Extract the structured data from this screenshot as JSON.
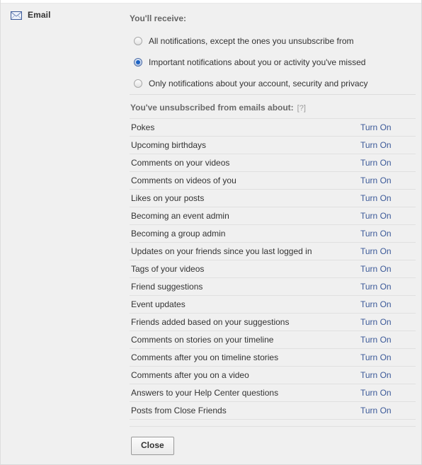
{
  "section": {
    "icon": "envelope-icon",
    "title": "Email"
  },
  "receive": {
    "heading": "You'll receive:",
    "options": [
      {
        "label": "All notifications, except the ones you unsubscribe from",
        "selected": false
      },
      {
        "label": "Important notifications about you or activity you've missed",
        "selected": true
      },
      {
        "label": "Only notifications about your account, security and privacy",
        "selected": false
      }
    ]
  },
  "unsubscribed": {
    "heading": "You've unsubscribed from emails about:",
    "help_label": "[?]",
    "action_label": "Turn On",
    "items": [
      "Pokes",
      "Upcoming birthdays",
      "Comments on your videos",
      "Comments on videos of you",
      "Likes on your posts",
      "Becoming an event admin",
      "Becoming a group admin",
      "Updates on your friends since you last logged in",
      "Tags of your videos",
      "Friend suggestions",
      "Event updates",
      "Friends added based on your suggestions",
      "Comments on stories on your timeline",
      "Comments after you on timeline stories",
      "Comments after you on a video",
      "Answers to your Help Center questions",
      "Posts from Close Friends"
    ]
  },
  "footer": {
    "close_label": "Close"
  },
  "colors": {
    "link": "#3b5998",
    "page_bg": "#f0f0f0",
    "divider": "#e0e0e0",
    "text": "#333333",
    "muted": "#6a6a6a"
  }
}
